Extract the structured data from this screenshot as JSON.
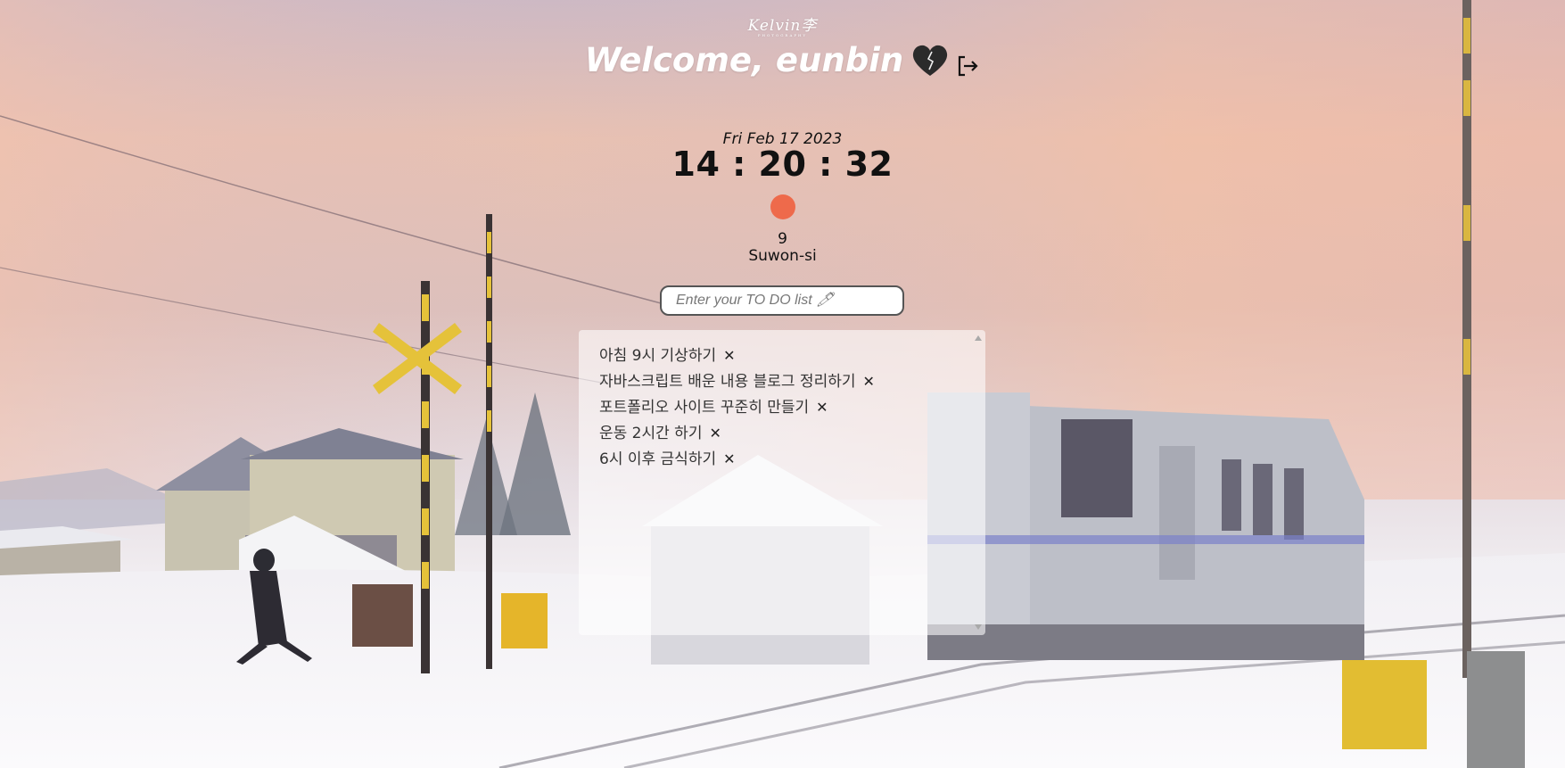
{
  "header": {
    "logo_text": "Kelvin李",
    "logo_subtext": "PHOTOGRAPHY",
    "welcome_text": "Welcome, eunbin"
  },
  "icons": {
    "heart": "black-heart-icon",
    "logout": "logout-icon",
    "weather": "weather-icon",
    "delete": "close-icon"
  },
  "clock": {
    "date": "Fri Feb 17 2023",
    "time": "14 : 20 : 32"
  },
  "weather": {
    "temperature": "9",
    "city": "Suwon-si",
    "icon_color": "#ee6a4b"
  },
  "todo": {
    "placeholder": "Enter your TO DO list 🖊",
    "delete_label": "✕",
    "items": [
      "아침 9시 기상하기",
      "자바스크립트 배운 내용 블로그 정리하기",
      "포트폴리오 사이트 꾸준히 만들기",
      "운동 2시간 하기",
      "6시 이후 금식하기"
    ]
  }
}
